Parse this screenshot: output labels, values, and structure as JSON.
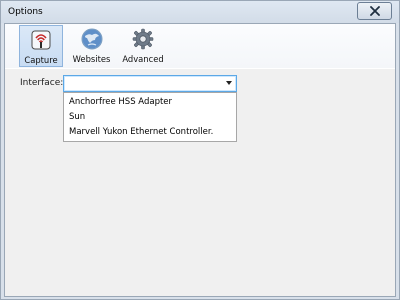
{
  "window": {
    "title": "Options"
  },
  "toolbar": {
    "tabs": [
      {
        "label": "Capture",
        "icon": "capture-icon",
        "active": true
      },
      {
        "label": "Websites",
        "icon": "globe-icon",
        "active": false
      },
      {
        "label": "Advanced",
        "icon": "gear-icon",
        "active": false
      }
    ]
  },
  "interface": {
    "label": "Interface:",
    "selected_value": "",
    "options": [
      "Anchorfree HSS Adapter",
      "Sun",
      "Marvell Yukon Ethernet Controller."
    ]
  },
  "colors": {
    "titlebar": "#d8e0ea",
    "active_tab": "#c8dcf3",
    "focus_border": "#5ca8e6",
    "background": "#f0f0f0"
  }
}
